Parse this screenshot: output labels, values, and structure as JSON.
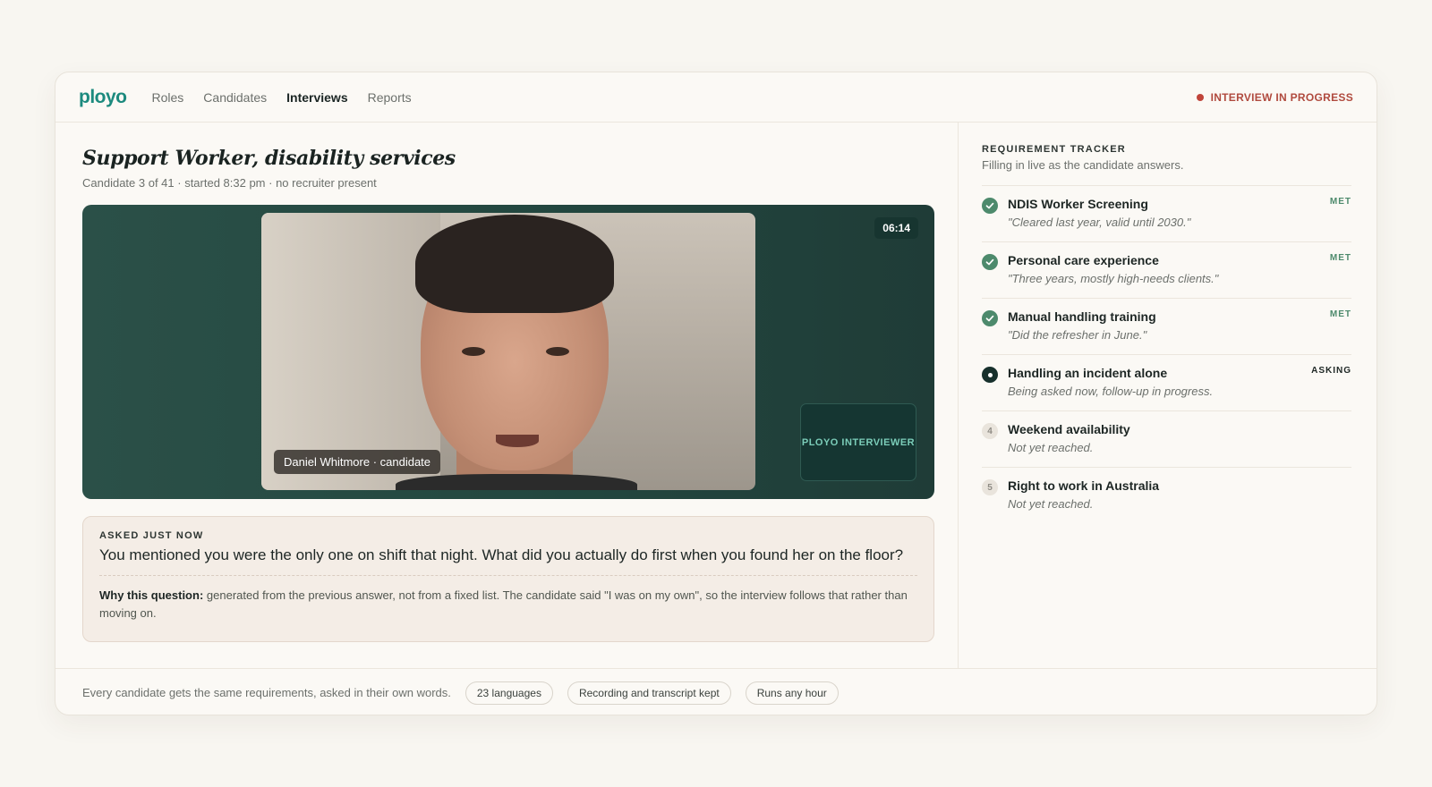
{
  "app": {
    "logo": "ployo"
  },
  "nav": {
    "items": [
      {
        "label": "Roles",
        "active": false
      },
      {
        "label": "Candidates",
        "active": false
      },
      {
        "label": "Interviews",
        "active": true
      },
      {
        "label": "Reports",
        "active": false
      }
    ],
    "status": "INTERVIEW IN PROGRESS"
  },
  "interview": {
    "title": "Support Worker, disability services",
    "subtitle": "Candidate 3 of 41 · started 8:32 pm · no recruiter present"
  },
  "video": {
    "timer": "06:14",
    "candidate_tag": "Daniel Whitmore · candidate",
    "interviewer_label": "PLOYO INTERVIEWER"
  },
  "question": {
    "label": "ASKED JUST NOW",
    "text": "You mentioned you were the only one on shift that night. What did you actually do first when you found her on the floor?",
    "why_label": "Why this question:",
    "why_text": "generated from the previous answer, not from a fixed list. The candidate said \"I was on my own\", so the interview follows that rather than moving on."
  },
  "tracker": {
    "title": "REQUIREMENT TRACKER",
    "subtitle": "Filling in live as the candidate answers.",
    "items": [
      {
        "name": "NDIS Worker Screening",
        "note": "\"Cleared last year, valid until 2030.\"",
        "status": "MET",
        "state": "met"
      },
      {
        "name": "Personal care experience",
        "note": "\"Three years, mostly high-needs clients.\"",
        "status": "MET",
        "state": "met"
      },
      {
        "name": "Manual handling training",
        "note": "\"Did the refresher in June.\"",
        "status": "MET",
        "state": "met"
      },
      {
        "name": "Handling an incident alone",
        "note": "Being asked now, follow-up in progress.",
        "status": "ASKING",
        "state": "asking"
      },
      {
        "name": "Weekend availability",
        "note": "Not yet reached.",
        "status": "",
        "state": "pending",
        "number": "4"
      },
      {
        "name": "Right to work in Australia",
        "note": "Not yet reached.",
        "status": "",
        "state": "pending",
        "number": "5"
      }
    ]
  },
  "footer": {
    "text": "Every candidate gets the same requirements, asked in their own words.",
    "chips": [
      "23 languages",
      "Recording and transcript kept",
      "Runs any hour"
    ]
  }
}
